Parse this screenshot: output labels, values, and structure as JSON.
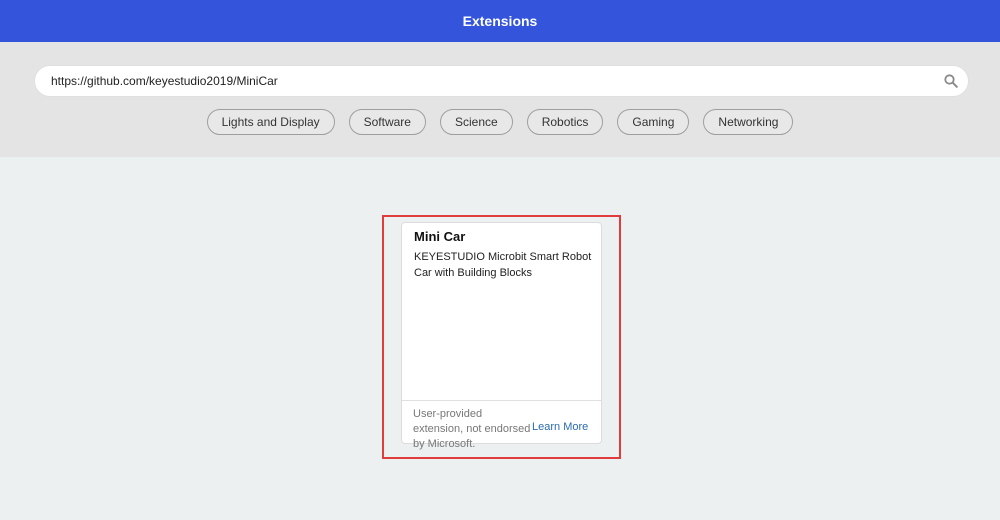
{
  "header": {
    "title": "Extensions"
  },
  "search": {
    "value": "https://github.com/keyestudio2019/MiniCar",
    "icon": "search-icon"
  },
  "categories": [
    "Lights and Display",
    "Software",
    "Science",
    "Robotics",
    "Gaming",
    "Networking"
  ],
  "result_card": {
    "title": "Mini Car",
    "description": "KEYESTUDIO Microbit Smart Robot Car with Building Blocks",
    "footer_text": "User-provided extension, not endorsed by Microsoft.",
    "learn_more_label": "Learn More"
  },
  "colors": {
    "header_bg": "#3455db",
    "highlight_border": "#e03c3c",
    "link": "#2b6cb0"
  }
}
